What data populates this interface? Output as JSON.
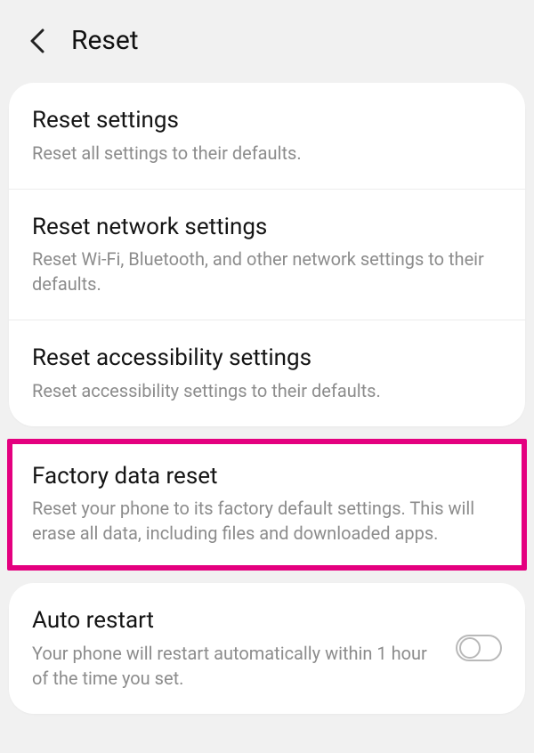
{
  "header": {
    "title": "Reset"
  },
  "reset_group": {
    "items": [
      {
        "title": "Reset settings",
        "desc": "Reset all settings to their defaults."
      },
      {
        "title": "Reset network settings",
        "desc": "Reset Wi-Fi, Bluetooth, and other network settings to their defaults."
      },
      {
        "title": "Reset accessibility settings",
        "desc": "Reset accessibility settings to their defaults."
      }
    ]
  },
  "factory_reset": {
    "title": "Factory data reset",
    "desc": "Reset your phone to its factory default settings. This will erase all data, including files and downloaded apps."
  },
  "auto_restart": {
    "title": "Auto restart",
    "desc": "Your phone will restart automatically within 1 hour of the time you set.",
    "enabled": false
  },
  "annotation": {
    "highlight_color": "#e4007f"
  }
}
